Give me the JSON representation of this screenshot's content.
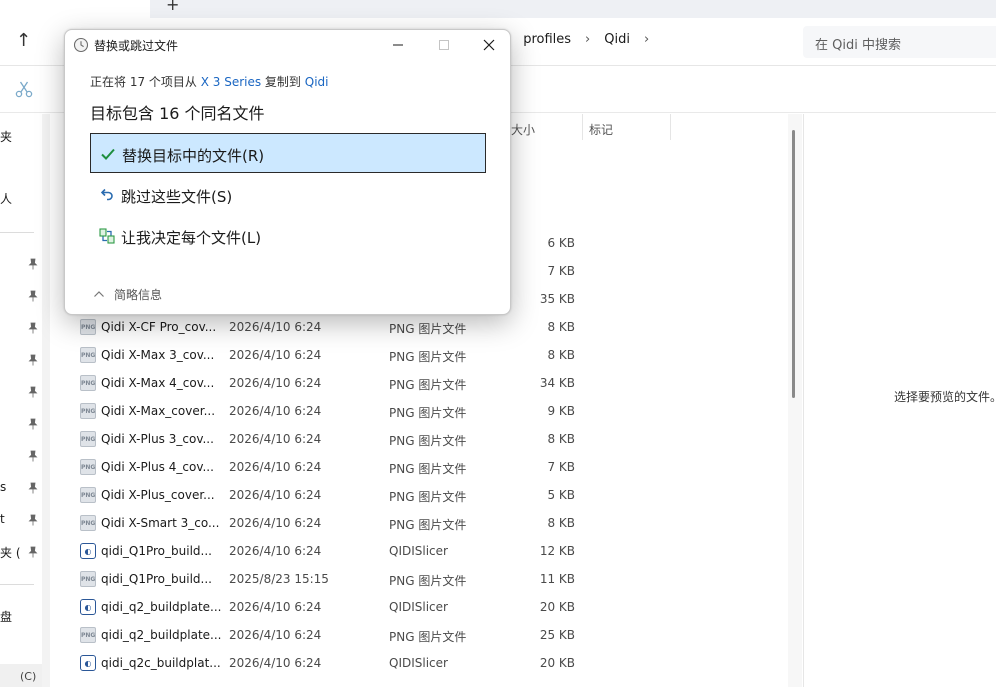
{
  "dialog": {
    "title": "替换或跳过文件",
    "info": {
      "prefix": "正在将 17 个项目从 ",
      "source": "X 3 Series",
      "middle": " 复制到 ",
      "destination": "Qidi"
    },
    "heading": "目标包含 16 个同名文件",
    "options": [
      {
        "label": "替换目标中的文件(R)",
        "icon": "check-icon",
        "selected": true
      },
      {
        "label": "跳过这些文件(S)",
        "icon": "undo-arrow-icon",
        "selected": false
      },
      {
        "label": "让我决定每个文件(L)",
        "icon": "decide-icon",
        "selected": false
      }
    ],
    "details_label": "简略信息",
    "controls": {
      "minimize": "minimize-icon",
      "maximize": "maximize-icon",
      "close": "close-icon"
    }
  },
  "explorer": {
    "new_tab_label": "+",
    "breadcrumb": [
      "profiles",
      "Qidi"
    ],
    "breadcrumb_separator": "›",
    "search_placeholder": "在 Qidi 中搜索",
    "columns": {
      "size": "大小",
      "tags": "标记"
    },
    "nav_fragments": [
      "夹",
      "人",
      "s",
      "t",
      "夹 (",
      "盘",
      "(C)"
    ],
    "preview_text": "选择要预览的文件。",
    "partial_sizes": [
      "6 KB",
      "7 KB",
      "35 KB"
    ],
    "files": [
      {
        "name": "Qidi X-CF Pro_cov...",
        "date": "2026/4/10 6:24",
        "type": "PNG 图片文件",
        "size": "8 KB",
        "icon": "png"
      },
      {
        "name": "Qidi X-Max 3_cov...",
        "date": "2026/4/10 6:24",
        "type": "PNG 图片文件",
        "size": "8 KB",
        "icon": "png"
      },
      {
        "name": "Qidi X-Max 4_cov...",
        "date": "2026/4/10 6:24",
        "type": "PNG 图片文件",
        "size": "34 KB",
        "icon": "png"
      },
      {
        "name": "Qidi X-Max_cover...",
        "date": "2026/4/10 6:24",
        "type": "PNG 图片文件",
        "size": "9 KB",
        "icon": "png"
      },
      {
        "name": "Qidi X-Plus 3_cov...",
        "date": "2026/4/10 6:24",
        "type": "PNG 图片文件",
        "size": "8 KB",
        "icon": "png"
      },
      {
        "name": "Qidi X-Plus 4_cov...",
        "date": "2026/4/10 6:24",
        "type": "PNG 图片文件",
        "size": "7 KB",
        "icon": "png"
      },
      {
        "name": "Qidi X-Plus_cover...",
        "date": "2026/4/10 6:24",
        "type": "PNG 图片文件",
        "size": "5 KB",
        "icon": "png"
      },
      {
        "name": "Qidi X-Smart 3_co...",
        "date": "2026/4/10 6:24",
        "type": "PNG 图片文件",
        "size": "8 KB",
        "icon": "png"
      },
      {
        "name": "qidi_Q1Pro_build...",
        "date": "2026/4/10 6:24",
        "type": "QIDISlicer",
        "size": "12 KB",
        "icon": "qidi"
      },
      {
        "name": "qidi_Q1Pro_build...",
        "date": "2025/8/23 15:15",
        "type": "PNG 图片文件",
        "size": "11 KB",
        "icon": "png"
      },
      {
        "name": "qidi_q2_buildplate...",
        "date": "2026/4/10 6:24",
        "type": "QIDISlicer",
        "size": "20 KB",
        "icon": "qidi"
      },
      {
        "name": "qidi_q2_buildplate...",
        "date": "2026/4/10 6:24",
        "type": "PNG 图片文件",
        "size": "25 KB",
        "icon": "png"
      },
      {
        "name": "qidi_q2c_buildplat...",
        "date": "2026/4/10 6:24",
        "type": "QIDISlicer",
        "size": "20 KB",
        "icon": "qidi"
      }
    ]
  },
  "colors": {
    "accent": "#1a66c2",
    "selection_fill": "#cce8ff",
    "selection_border": "#2a2a2a",
    "check_green": "#1e8e3e"
  }
}
